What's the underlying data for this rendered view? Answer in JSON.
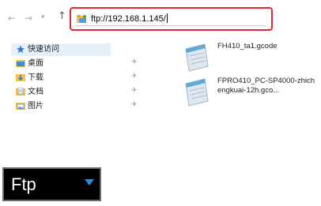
{
  "address_bar": {
    "path": "ftp://192.168.1.145/"
  },
  "sidebar": {
    "items": [
      {
        "label": "快速访问",
        "icon": "star-icon",
        "color": "#2f7fd6"
      },
      {
        "label": "桌面",
        "icon": "desktop-folder-icon",
        "color": "#3c8fdc"
      },
      {
        "label": "下载",
        "icon": "download-folder-icon",
        "color": "#2f7fd6"
      },
      {
        "label": "文档",
        "icon": "documents-folder-icon",
        "color": "#6f9ad0"
      },
      {
        "label": "图片",
        "icon": "pictures-folder-icon",
        "color": "#5b8fd0"
      }
    ]
  },
  "files": [
    {
      "name": "FH410_ta1.gcode",
      "icon": "notepad-file-icon"
    },
    {
      "name": "FPRO410_PC-SP4000-zhichengkuai-12h.gco...",
      "icon": "notepad-file-icon"
    }
  ],
  "device_dropdown": {
    "value": "Ftp",
    "arrow_color": "#1e90e8"
  },
  "colors": {
    "highlight_border": "#e8262b",
    "quick_access_bg": "#e5f0fb"
  }
}
